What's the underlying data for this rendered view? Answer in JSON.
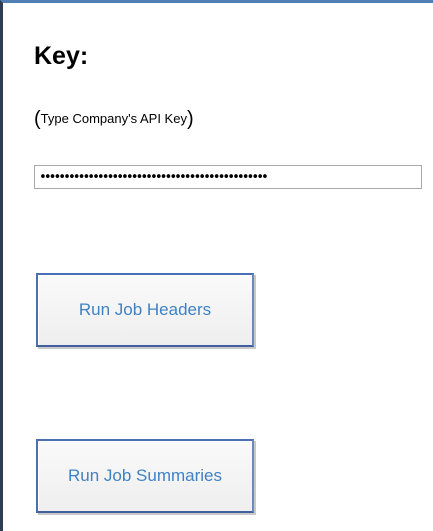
{
  "key_section": {
    "title": "Key:",
    "hint_open": "(",
    "hint_text": "Type Company's API Key",
    "hint_close": ")"
  },
  "api_key_field": {
    "value": "•••••••••••••••••••••••••••••••••••••••••••••••"
  },
  "buttons": {
    "run_job_headers": "Run Job Headers",
    "run_job_summaries": "Run Job Summaries"
  },
  "colors": {
    "frame_border_top": "#4f7fb4",
    "frame_border_left": "#2f3d52",
    "button_border": "#4a6fb5",
    "button_text": "#3f82c4"
  }
}
